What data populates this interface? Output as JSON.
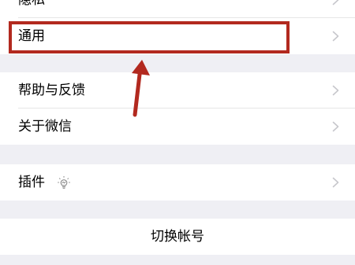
{
  "groups": [
    {
      "items": [
        {
          "label": "隐私",
          "id": "privacy"
        },
        {
          "label": "通用",
          "id": "general"
        }
      ]
    },
    {
      "items": [
        {
          "label": "帮助与反馈",
          "id": "help-feedback"
        },
        {
          "label": "关于微信",
          "id": "about-wechat"
        }
      ]
    },
    {
      "items": [
        {
          "label": "插件",
          "id": "plugins",
          "icon": "lightbulb-icon"
        }
      ]
    }
  ],
  "switch_account": {
    "label": "切换帐号"
  },
  "annotation": {
    "highlight_color": "#b2291f",
    "arrow_color": "#b2291f"
  },
  "colors": {
    "background": "#efeff4",
    "cell": "#ffffff",
    "separator": "#e6e6e6",
    "chevron": "#c7c7cc"
  }
}
